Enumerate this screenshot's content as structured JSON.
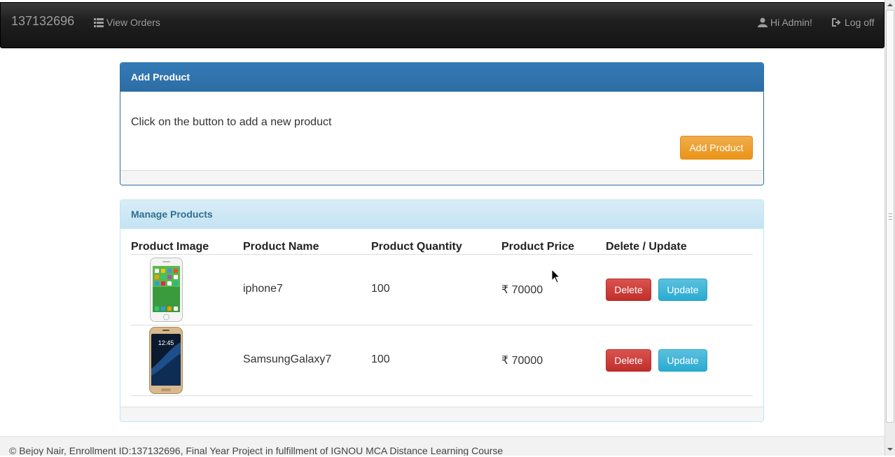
{
  "navbar": {
    "brand": "137132696",
    "view_orders": "View Orders",
    "greeting": "Hi Admin!",
    "logoff": "Log off"
  },
  "add_panel": {
    "title": "Add Product",
    "text": "Click on the button to add a new product",
    "button": "Add Product"
  },
  "manage_panel": {
    "title": "Manage Products",
    "columns": [
      "Product Image",
      "Product Name",
      "Product Quantity",
      "Product Price",
      "Delete / Update"
    ],
    "rows": [
      {
        "name": "iphone7",
        "quantity": "100",
        "price": "₹ 70000",
        "delete": "Delete",
        "update": "Update",
        "image_icon": "iphone-image"
      },
      {
        "name": "SamsungGalaxy7",
        "quantity": "100",
        "price": "₹ 70000",
        "delete": "Delete",
        "update": "Update",
        "image_icon": "samsung-galaxy-image"
      }
    ]
  },
  "footer": {
    "text": "© Bejoy Nair, Enrollment ID:137132696, Final Year Project in fulfillment of IGNOU MCA Distance Learning Course"
  },
  "colors": {
    "primary": "#337ab7",
    "warning": "#f0ad4e",
    "danger": "#d9534f",
    "info": "#5bc0de"
  }
}
